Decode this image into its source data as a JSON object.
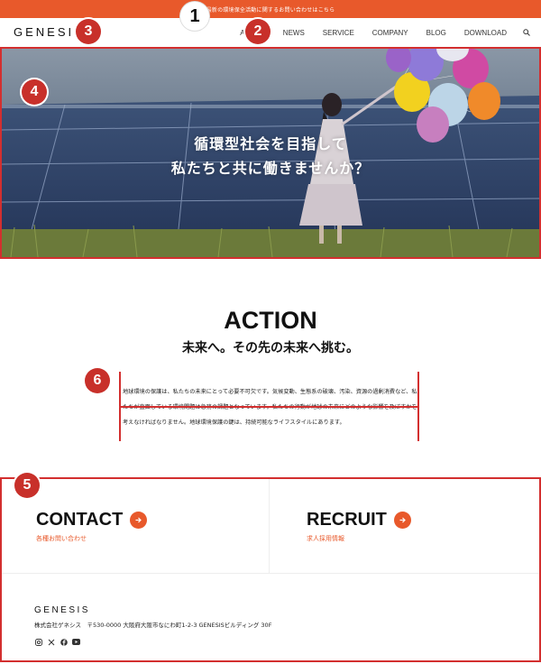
{
  "announcement": "最新の環境保全活動に関するお問い合わせはこちら",
  "header": {
    "logo": "GENESIS",
    "nav": [
      "ABOUT",
      "NEWS",
      "SERVICE",
      "COMPANY",
      "BLOG",
      "DOWNLOAD"
    ],
    "search_icon": "search-icon"
  },
  "hero": {
    "line1": "循環型社会を目指して",
    "line2": "私たちと共に働きませんか？"
  },
  "action": {
    "title": "ACTION",
    "subtitle": "未来へ。その先の未来へ挑む。",
    "body": "地球環境の保護は、私たちの未来にとって必要不可欠です。気候変動、生態系の破壊、汚染、資源の過剰消費など、私たちが直面している環境問題は急務の課題となっています。私たちの行動が地球の未来にどのような影響を及ぼすかを考えなければなりません。地球環境保護の鍵は、持続可能なライフスタイルにあります。"
  },
  "cta": {
    "contact": {
      "title": "CONTACT",
      "sub": "各種お問い合わせ"
    },
    "recruit": {
      "title": "RECRUIT",
      "sub": "求人採用情報"
    }
  },
  "footer": {
    "logo": "GENESIS",
    "address": "株式会社ゲネシス　〒530-0000 大阪府大阪市なにわ町1-2-3 GENESISビルディング 30F",
    "social": [
      "instagram-icon",
      "x-icon",
      "facebook-icon",
      "youtube-icon"
    ]
  },
  "markers": [
    "1",
    "2",
    "3",
    "4",
    "5",
    "6"
  ],
  "colors": {
    "accent": "#e8592b",
    "highlight": "#d32f2f"
  }
}
